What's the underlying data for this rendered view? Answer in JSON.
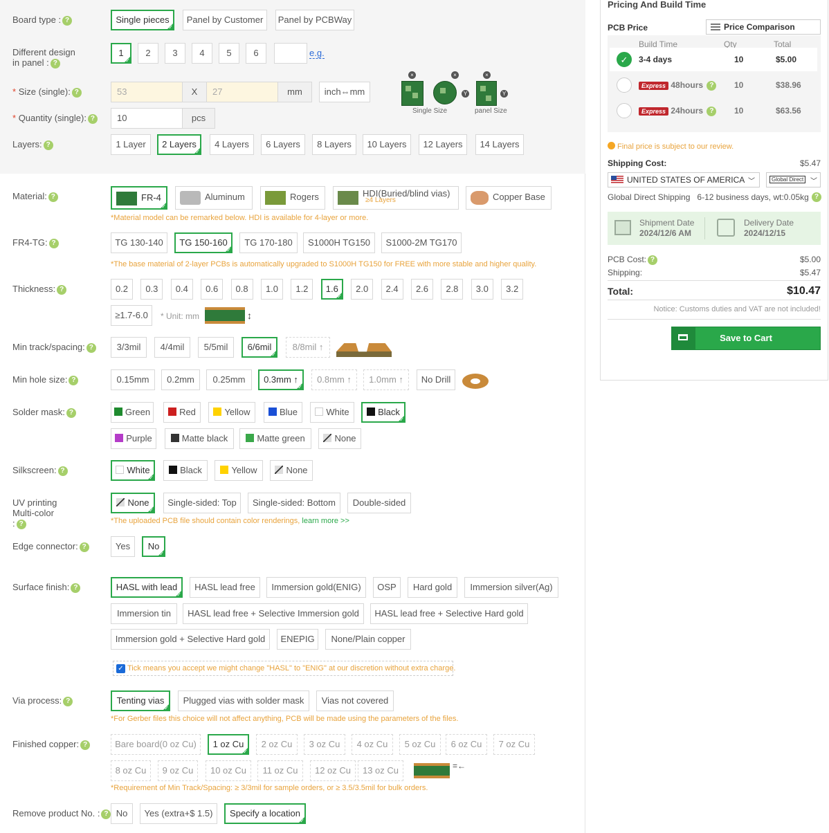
{
  "colors": {
    "accent": "#2aa84a",
    "note": "#e8a33c",
    "required": "#e0452c",
    "express": "#c0272d",
    "link": "#2a6ad8"
  },
  "help_glyph": "?",
  "board_type": {
    "label": "Board type :",
    "options": [
      "Single pieces",
      "Panel by Customer",
      "Panel by PCBWay"
    ],
    "selected": "Single pieces"
  },
  "diff_design": {
    "label_line1": "Different design",
    "label_line2": "in panel :",
    "options": [
      "1",
      "2",
      "3",
      "4",
      "5",
      "6"
    ],
    "selected": "1",
    "eg_link": "e.g."
  },
  "size": {
    "req": "*",
    "label": "Size (single):",
    "width_placeholder": "53",
    "x_sep": "X",
    "height_placeholder": "27",
    "unit": "mm",
    "convert_button": "inch⇔mm",
    "single_caption": "Single Size",
    "panel_caption": "panel Size"
  },
  "quantity": {
    "req": "*",
    "label": "Quantity (single):",
    "value": "10",
    "unit": "pcs"
  },
  "layers": {
    "label": "Layers:",
    "options": [
      "1 Layer",
      "2 Layers",
      "4 Layers",
      "6 Layers",
      "8 Layers",
      "10 Layers",
      "12 Layers",
      "14 Layers"
    ],
    "selected": "2 Layers"
  },
  "material": {
    "label": "Material:",
    "options": [
      "FR-4",
      "Aluminum",
      "Rogers",
      "HDI(Buried/blind vias)",
      "Copper Base"
    ],
    "hdi_sub": "≥4 Layers",
    "selected": "FR-4",
    "note": "*Material model can be remarked below. HDI is available for 4-layer or more."
  },
  "fr4_tg": {
    "label": "FR4-TG:",
    "options": [
      "TG 130-140",
      "TG 150-160",
      "TG 170-180",
      "S1000H TG150",
      "S1000-2M TG170"
    ],
    "selected": "TG 150-160",
    "note": "*The base material of 2-layer PCBs is automatically upgraded to S1000H TG150 for FREE with more stable and higher quality."
  },
  "thickness": {
    "label": "Thickness:",
    "options": [
      "0.2",
      "0.3",
      "0.4",
      "0.6",
      "0.8",
      "1.0",
      "1.2",
      "1.6",
      "2.0",
      "2.4",
      "2.6",
      "2.8",
      "3.0",
      "3.2"
    ],
    "extra": "≥1.7-6.0",
    "unit_note": "* Unit: mm",
    "selected": "1.6"
  },
  "track": {
    "label": "Min track/spacing:",
    "options": [
      "3/3mil",
      "4/4mil",
      "5/5mil",
      "6/6mil",
      "8/8mil ↑"
    ],
    "selected": "6/6mil"
  },
  "hole": {
    "label": "Min hole size:",
    "options": [
      "0.15mm",
      "0.2mm",
      "0.25mm",
      "0.3mm ↑",
      "0.8mm ↑",
      "1.0mm ↑",
      "No Drill"
    ],
    "selected": "0.3mm ↑"
  },
  "solder": {
    "label": "Solder mask:",
    "options": [
      {
        "name": "Green",
        "color": "#1e8a2e"
      },
      {
        "name": "Red",
        "color": "#cc1f1f"
      },
      {
        "name": "Yellow",
        "color": "#ffd200"
      },
      {
        "name": "Blue",
        "color": "#1a4fd6"
      },
      {
        "name": "White",
        "color": "#ffffff"
      },
      {
        "name": "Black",
        "color": "#111111"
      },
      {
        "name": "Purple",
        "color": "#b43cc8"
      },
      {
        "name": "Matte black",
        "color": "#333333"
      },
      {
        "name": "Matte green",
        "color": "#3aa84a"
      },
      {
        "name": "None",
        "color": "none"
      }
    ],
    "selected": "Black"
  },
  "silkscreen": {
    "label": "Silkscreen:",
    "options": [
      {
        "name": "White",
        "color": "#ffffff"
      },
      {
        "name": "Black",
        "color": "#111111"
      },
      {
        "name": "Yellow",
        "color": "#ffd200"
      },
      {
        "name": "None",
        "color": "none"
      }
    ],
    "selected": "White"
  },
  "uv": {
    "label_line1": "UV printing",
    "label_line2": "Multi-color",
    "label_line3": ":",
    "options": [
      "None",
      "Single-sided: Top",
      "Single-sided: Bottom",
      "Double-sided"
    ],
    "selected": "None",
    "note": "*The uploaded PCB file should contain color renderings,",
    "note_link": "learn more >>"
  },
  "edge": {
    "label": "Edge connector:",
    "options": [
      "Yes",
      "No"
    ],
    "selected": "No"
  },
  "surface": {
    "label": "Surface finish:",
    "options": [
      "HASL with lead",
      "HASL lead free",
      "Immersion gold(ENIG)",
      "OSP",
      "Hard gold",
      "Immersion silver(Ag)",
      "Immersion tin",
      "HASL lead free + Selective Immersion gold",
      "HASL lead free + Selective Hard gold",
      "Immersion gold + Selective Hard gold",
      "ENEPIG",
      "None/Plain copper"
    ],
    "selected": "HASL with lead",
    "tick_text": "Tick means you accept we might change \"HASL\" to \"ENIG\" at our discretion without extra charge."
  },
  "via": {
    "label": "Via process:",
    "options": [
      "Tenting vias",
      "Plugged vias with solder mask",
      "Vias not covered"
    ],
    "selected": "Tenting vias",
    "note": "*For Gerber files this choice will not affect anything, PCB will be made using the parameters of the files."
  },
  "copper": {
    "label": "Finished copper:",
    "options": [
      "Bare board(0 oz Cu)",
      "1 oz Cu",
      "2 oz Cu",
      "3 oz Cu",
      "4 oz Cu",
      "5 oz Cu",
      "6 oz Cu",
      "7 oz Cu",
      "8 oz Cu",
      "9 oz Cu",
      "10 oz Cu",
      "11 oz Cu",
      "12 oz Cu",
      "13 oz Cu"
    ],
    "selected": "1 oz Cu",
    "note": "*Requirement of Min Track/Spacing: ≥ 3/3mil for sample orders, or ≥ 3.5/3.5mil for bulk orders."
  },
  "remove_no": {
    "label": "Remove product No. :",
    "options": [
      "No",
      "Yes (extra+$ 1.5)",
      "Specify a location"
    ],
    "selected": "Specify a location"
  },
  "pricing": {
    "title": "Pricing And Build Time",
    "pcb_price_label": "PCB Price",
    "matrix_button": "Price Comparison Matrix",
    "columns": [
      "Build Time",
      "Qty",
      "Total"
    ],
    "rows": [
      {
        "time": "3-4 days",
        "express": "",
        "qty": "10",
        "total": "$5.00",
        "selected": true
      },
      {
        "time": "48hours",
        "express": "Express",
        "qty": "10",
        "total": "$38.96",
        "selected": false
      },
      {
        "time": "24hours",
        "express": "Express",
        "qty": "10",
        "total": "$63.56",
        "selected": false
      }
    ],
    "final_note": "Final price is subject to our review.",
    "shipping_label": "Shipping Cost:",
    "shipping_value": "$5.47",
    "country": "UNITED STATES OF AMERICA",
    "method": "Global Direct",
    "ship_info": "Global Direct Shipping   6-12 business days, wt:0.05kg",
    "shipment_label": "Shipment Date",
    "shipment_value": "2024/12/6 AM",
    "delivery_label": "Delivery Date",
    "delivery_value": "2024/12/15",
    "pcb_cost_label": "PCB Cost:",
    "pcb_cost_value": "$5.00",
    "shipping2_label": "Shipping:",
    "shipping2_value": "$5.47",
    "total_label": "Total:",
    "total_value": "$10.47",
    "customs_note": "Notice: Customs duties and VAT are not included!",
    "cart_button": "Save to Cart"
  }
}
